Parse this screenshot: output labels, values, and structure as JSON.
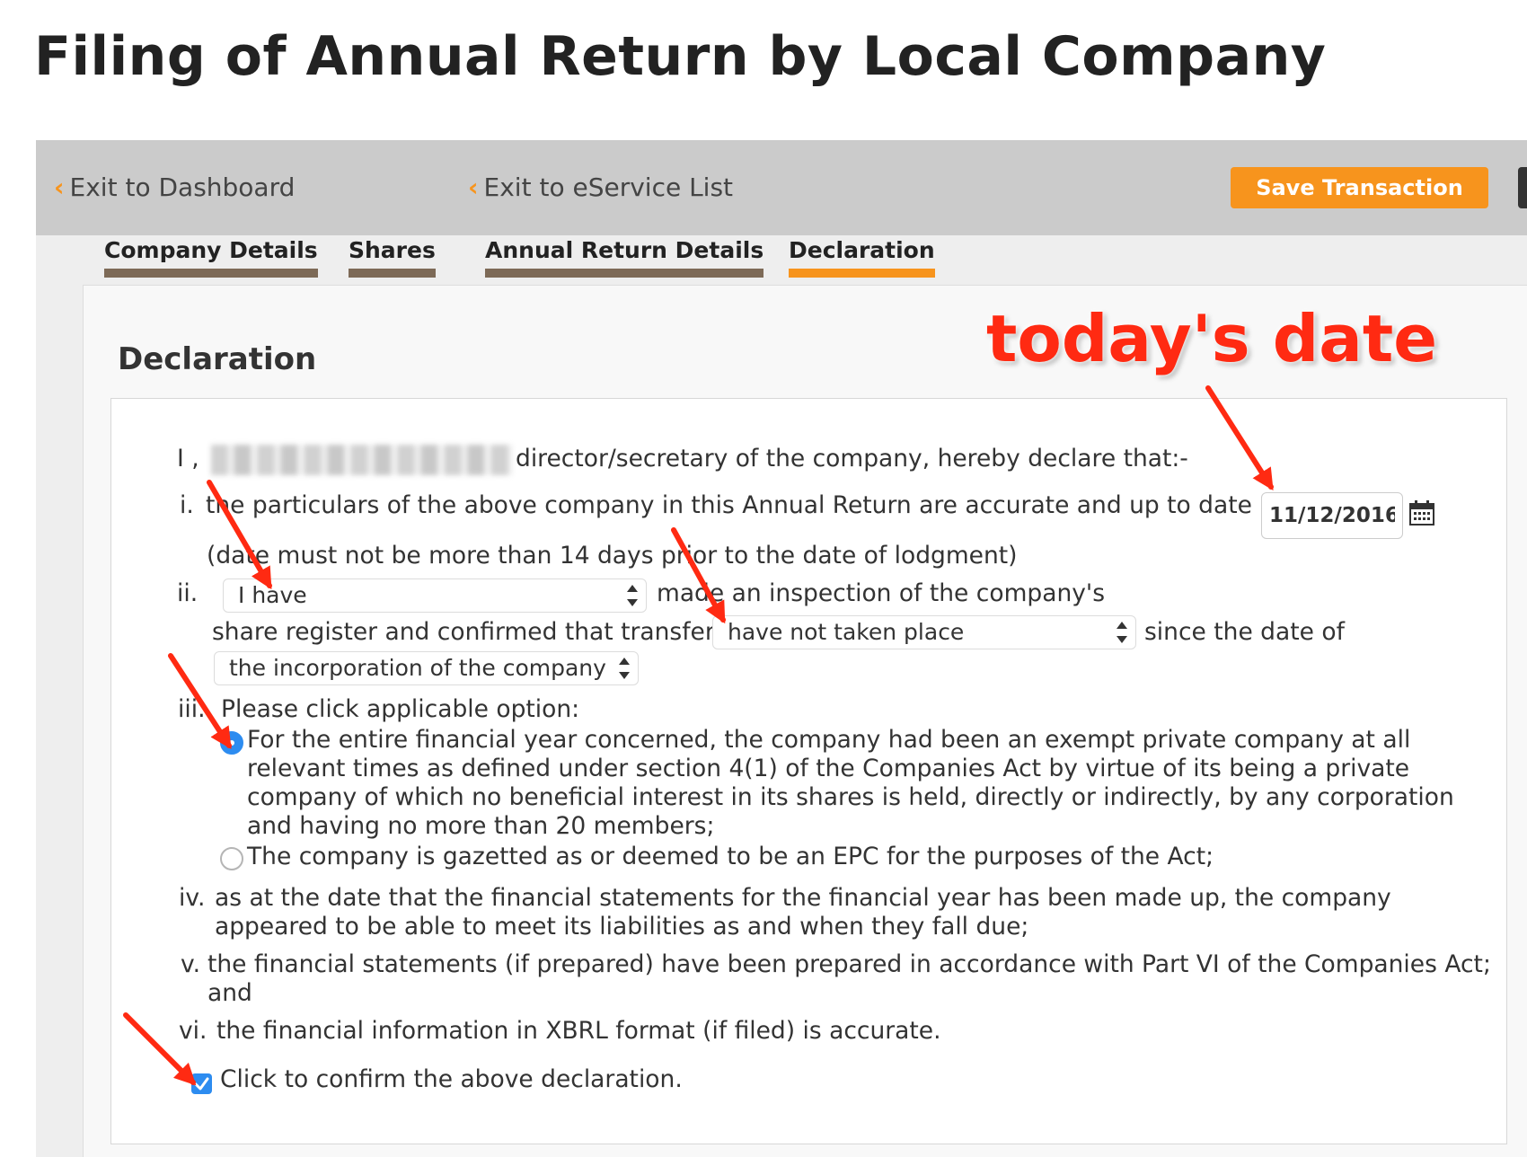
{
  "page_title": "Filing of Annual Return by Local Company",
  "toolbar": {
    "exit_dashboard": "Exit to Dashboard",
    "exit_eservice": "Exit to eService List",
    "save_label": "Save Transaction"
  },
  "tabs": [
    {
      "label": "Company Details",
      "active": false
    },
    {
      "label": "Shares",
      "active": false
    },
    {
      "label": "Annual Return Details",
      "active": false
    },
    {
      "label": "Declaration",
      "active": true
    }
  ],
  "section_title": "Declaration",
  "declaration": {
    "intro_prefix": "I ,",
    "intro_suffix": "director/secretary of the company, hereby declare that:-",
    "item_i_num": "i.",
    "item_i_text": "the particulars of the above company in this Annual Return are accurate and up to date as at",
    "date_value": "11/12/2016",
    "item_i_note": "(date must not be more than 14 days prior to the date of lodgment)",
    "item_ii_num": "ii.",
    "select_have": "I have",
    "item_ii_text1": "made an inspection of the company's",
    "item_ii_text2": "share register and confirmed that transfers",
    "select_transfers": "have not taken place",
    "item_ii_text3": "since the date of",
    "select_since": "the incorporation of the company",
    "item_iii_num": "iii.",
    "item_iii_text": "Please click applicable option:",
    "option_1_lines": [
      "For the entire financial year concerned, the company had been an exempt private company at all",
      "relevant times as defined under section 4(1) of the Companies Act by virtue of its being a private",
      "company of which no beneficial interest in its shares is held, directly or indirectly, by any corporation",
      "and having no more than 20 members;"
    ],
    "option_1_selected": true,
    "option_2": "The company is gazetted as or deemed to be an EPC for the purposes of the Act;",
    "option_2_selected": false,
    "item_iv_num": "iv.",
    "item_iv_lines": [
      "as at the date that the financial statements for the financial year has been made up, the company",
      "appeared to be able to meet its liabilities as and when they fall due;"
    ],
    "item_v_num": "v.",
    "item_v_lines": [
      "the financial statements (if prepared) have been prepared in accordance with Part VI of the Companies Act;",
      "and"
    ],
    "item_vi_num": "vi.",
    "item_vi_text": "the financial information in XBRL format (if filed) is accurate.",
    "confirm_label": "Click to confirm the above declaration.",
    "confirm_checked": true
  },
  "annotation": {
    "label": "today's date",
    "color": "#ff2a12"
  },
  "icons": {
    "back_chevron": "chevron-left-icon",
    "calendar": "calendar-icon",
    "select_arrows": "select-arrows-icon"
  },
  "colors": {
    "accent": "#f7941d",
    "tab_inactive": "#7d6a57",
    "topbar": "#cbcbcb",
    "selected_control": "#2d8cf0"
  }
}
